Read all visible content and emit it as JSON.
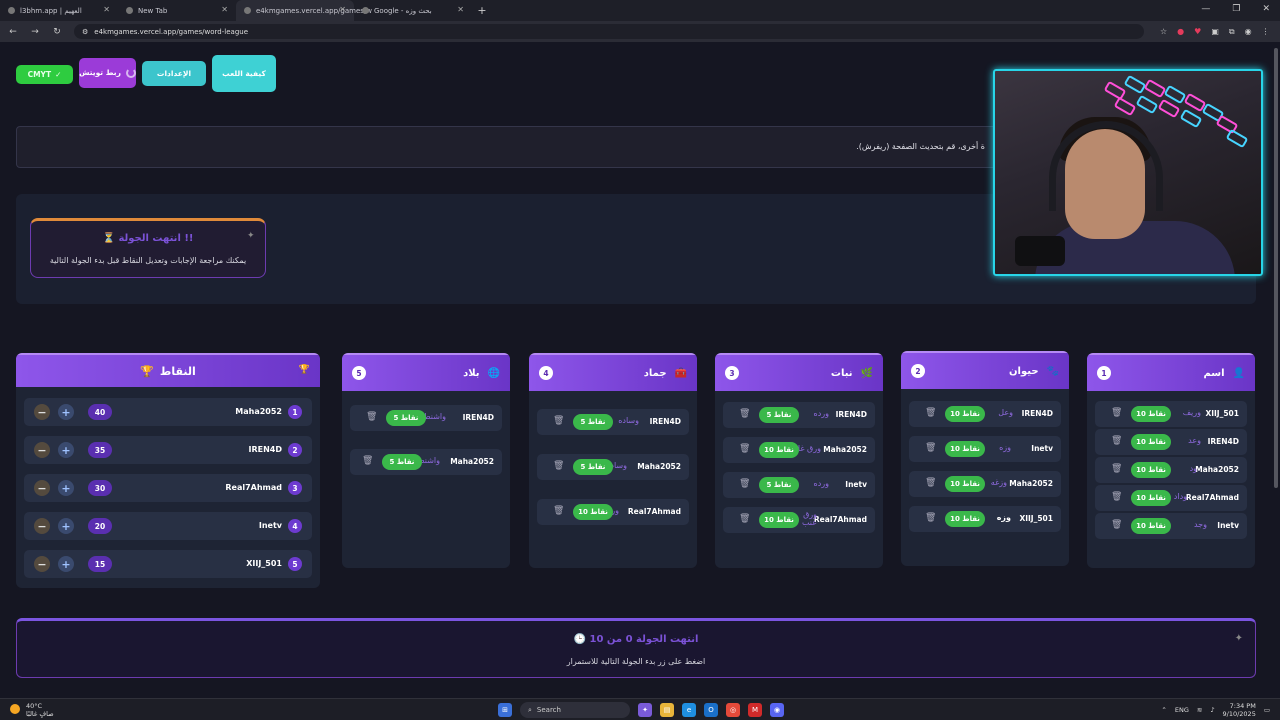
{
  "browser": {
    "tabs": [
      {
        "label": "l3bhm.app | العهيم"
      },
      {
        "label": "New Tab"
      },
      {
        "label": "e4kmgames.vercel.app/games/w"
      },
      {
        "label": "Google - بحث وزه"
      }
    ],
    "url": "e4kmgames.vercel.app/games/word-league"
  },
  "toolbar": {
    "cmyt_label": "CMYT",
    "twitch_label": "ربط تويتش",
    "settings_label": "الإعدادات",
    "howto_label": "كيفية اللعب"
  },
  "notice": {
    "text": "ة أخرى، قم بتحديث الصفحة (ريفرش)."
  },
  "round_end": {
    "title": "⏳ انتهت الجولة !!",
    "subtitle": "يمكنك مراجعة الإجابات وتعديل النقاط قبل بدء الجولة التالية"
  },
  "scores": {
    "title": "النقاط",
    "rows": [
      {
        "rank": "1",
        "name": "Maha2052",
        "points": "40"
      },
      {
        "rank": "2",
        "name": "IREN4D",
        "points": "35"
      },
      {
        "rank": "3",
        "name": "Real7Ahmad",
        "points": "30"
      },
      {
        "rank": "4",
        "name": "Inetv",
        "points": "20"
      },
      {
        "rank": "5",
        "name": "XIIJ_501",
        "points": "15"
      }
    ]
  },
  "categories": [
    {
      "num": "1",
      "title": "اسم",
      "answers": [
        {
          "name": "XIIJ_501",
          "word": "وريف",
          "points": "10 نقاط"
        },
        {
          "name": "IREN4D",
          "word": "وعد",
          "points": "10 نقاط"
        },
        {
          "name": "Maha2052",
          "word": "ود",
          "points": "10 نقاط"
        },
        {
          "name": "Real7Ahmad",
          "word": "وداد",
          "points": "10 نقاط"
        },
        {
          "name": "Inetv",
          "word": "وجد",
          "points": "10 نقاط"
        }
      ]
    },
    {
      "num": "2",
      "title": "حيوان",
      "answers": [
        {
          "name": "IREN4D",
          "word": "وعل",
          "points": "10 نقاط"
        },
        {
          "name": "Inetv",
          "word": "وزه",
          "points": "10 نقاط"
        },
        {
          "name": "Maha2052",
          "word": "وزغه",
          "points": "10 نقاط"
        },
        {
          "name": "XIIJ_501",
          "word": "وزه",
          "points": "10 نقاط"
        }
      ]
    },
    {
      "num": "3",
      "title": "نبات",
      "answers": [
        {
          "name": "IREN4D",
          "word": "ورده",
          "points": "5 نقاط"
        },
        {
          "name": "Maha2052",
          "word": "ورق غار",
          "points": "10 نقاط"
        },
        {
          "name": "Inetv",
          "word": "ورده",
          "points": "5 نقاط"
        },
        {
          "name": "Real7Ahmad",
          "word": "ورق عنب",
          "points": "10 نقاط"
        }
      ]
    },
    {
      "num": "4",
      "title": "جماد",
      "answers": [
        {
          "name": "IREN4D",
          "word": "وساده",
          "points": "5 نقاط"
        },
        {
          "name": "Maha2052",
          "word": "وساده",
          "points": "5 نقاط"
        },
        {
          "name": "Real7Ahmad",
          "word": "ورقة",
          "points": "10 نقاط"
        }
      ]
    },
    {
      "num": "5",
      "title": "بلاد",
      "answers": [
        {
          "name": "IREN4D",
          "word": "واشنطن",
          "points": "5 نقاط"
        },
        {
          "name": "Maha2052",
          "word": "واشنطن",
          "points": "5 نقاط"
        }
      ]
    }
  ],
  "bottom": {
    "title": "🕒 انتهت الجولة 0 من 10",
    "subtitle": "اضغط على زر بدء الجولة التالية للاستمرار"
  },
  "taskbar": {
    "temp": "40°C",
    "weather": "صافٍ غالبًا",
    "search": "Search",
    "lang": "ENG",
    "time": "7:34 PM",
    "date": "9/10/2025"
  }
}
